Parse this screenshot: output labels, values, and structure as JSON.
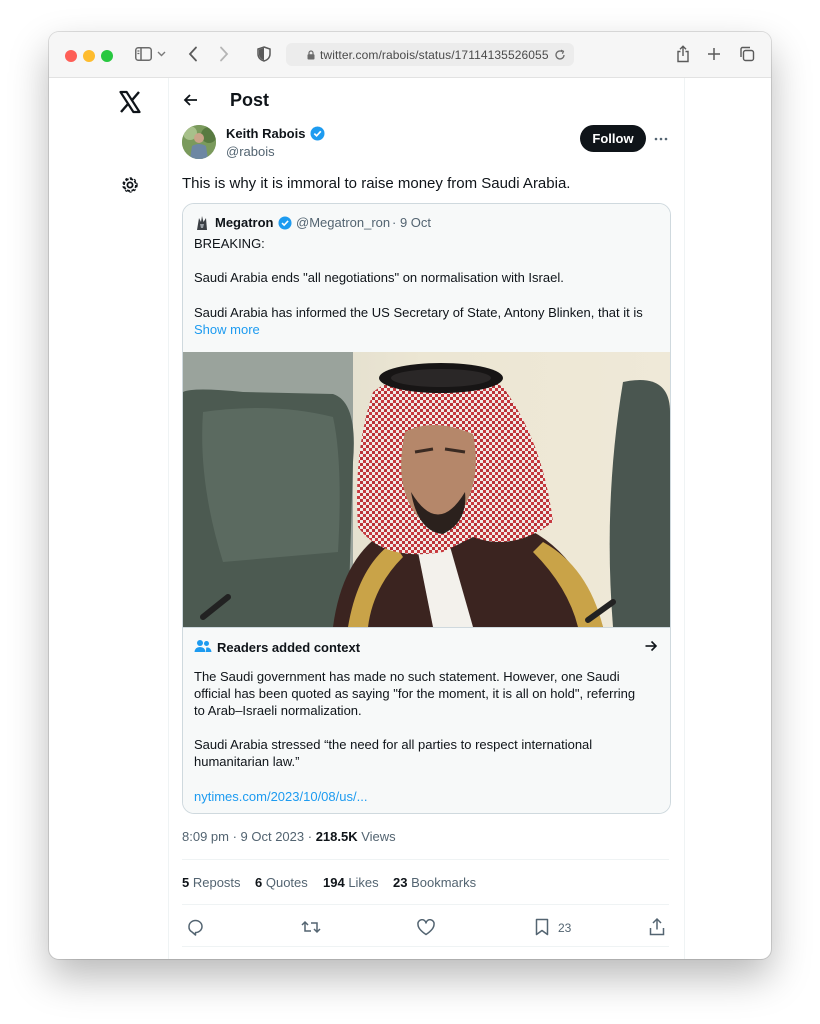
{
  "browser": {
    "url": "twitter.com/rabois/status/17114135526055"
  },
  "header": {
    "title": "Post"
  },
  "post": {
    "author_name": "Keith Rabois",
    "author_handle": "@rabois",
    "follow_label": "Follow",
    "text": "This is why it is immoral to raise money from Saudi Arabia.",
    "timestamp": "8:09 pm · 9 Oct 2023 · ",
    "views_count": "218.5K",
    "views_label": " Views"
  },
  "quote": {
    "author_name": "Megatron",
    "author_handle": "@Megatron_ron",
    "date": "· 9 Oct",
    "line1": "BREAKING:",
    "line2": "Saudi Arabia ends \"all negotiations\" on normalisation with Israel.",
    "line3": "Saudi Arabia has informed the US Secretary of State, Antony Blinken, that it is",
    "show_more": "Show more"
  },
  "community_note": {
    "title": "Readers added context",
    "line1": "The Saudi government has made no such statement. However, one Saudi",
    "line2": "official has been quoted as saying \"for the moment, it is all on hold\", referring",
    "line3": "to Arab–Israeli normalization.",
    "line4": "Saudi Arabia stressed “the need for all parties to respect international",
    "line5": "humanitarian law.”",
    "link": "nytimes.com/2023/10/08/us/..."
  },
  "stats": {
    "reposts_count": "5",
    "reposts_label": " Reposts",
    "quotes_count": "6",
    "quotes_label": " Quotes",
    "likes_count": "194",
    "likes_label": " Likes",
    "bookmarks_count": "23",
    "bookmarks_label": " Bookmarks"
  },
  "actions": {
    "bookmark_count": "23"
  },
  "colors": {
    "accent_blue": "#1d9bf0",
    "link_blue": "#1d9bf0",
    "text_dark": "#0f1419",
    "text_gray": "#536471"
  },
  "icons": [
    "x-logo-icon",
    "settings-gear-icon",
    "back-arrow-icon",
    "verified-badge-icon",
    "more-icon",
    "people-icon",
    "arrow-right-icon",
    "reply-icon",
    "repost-icon",
    "like-icon",
    "bookmark-icon",
    "share-icon"
  ]
}
